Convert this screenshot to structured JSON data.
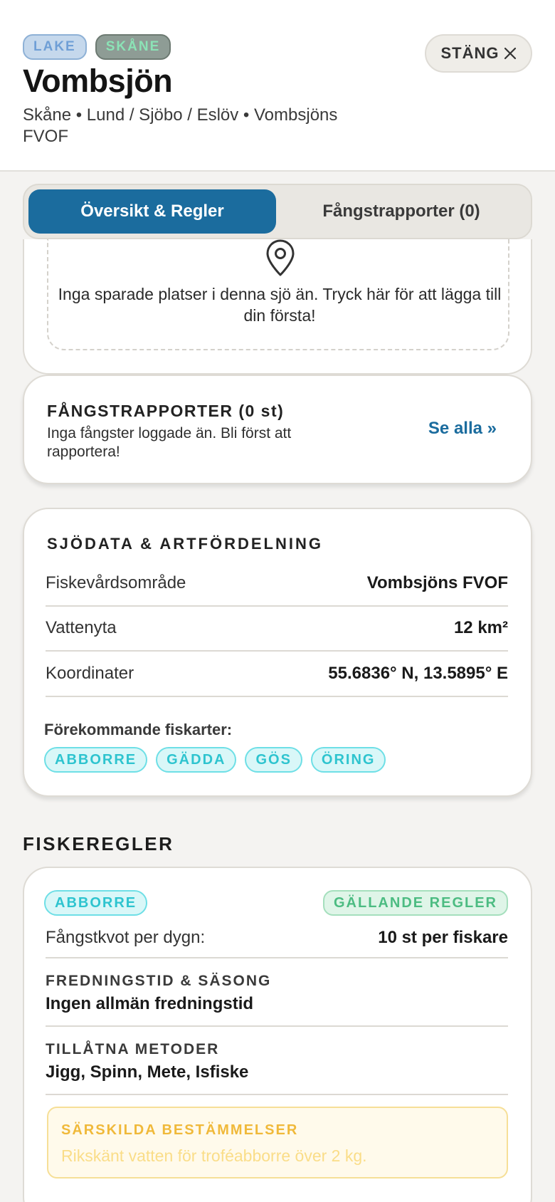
{
  "header": {
    "badges": {
      "type": "LAKE",
      "region": "SKÅNE"
    },
    "title": "Vombsjön",
    "subtitle": "Skåne • Lund / Sjöbo / Eslöv • Vombsjöns FVOF",
    "close_label": "STÄNG",
    "close_icon": "close-icon"
  },
  "tabs": {
    "overview": "Översikt & Regler",
    "reports": "Fångstrapporter (0)"
  },
  "places": {
    "icon": "map-pin-icon",
    "empty_text": "Inga sparade platser i denna sjö än. Tryck här för att lägga till din första!"
  },
  "catch_reports": {
    "title": "FÅNGSTRAPPORTER (0 st)",
    "empty_text": "Inga fångster loggade än. Bli först att rapportera!",
    "see_all": "Se alla »"
  },
  "lake_data": {
    "title": "SJÖDATA & ARTFÖRDELNING",
    "rows": [
      {
        "key": "Fiskevårdsområde",
        "value": "Vombsjöns FVOF"
      },
      {
        "key": "Vattenyta",
        "value": "12 km²"
      },
      {
        "key": "Koordinater",
        "value": "55.6836° N, 13.5895° E"
      }
    ],
    "species_label": "Förekommande fiskarter:",
    "species": [
      "ABBORRE",
      "GÄDDA",
      "GÖS",
      "ÖRING"
    ]
  },
  "rules": {
    "heading": "FISKEREGLER",
    "species": "ABBORRE",
    "status": "GÄLLANDE REGLER",
    "quota_label": "Fångstkvot per dygn:",
    "quota_value": "10 st per fiskare",
    "season_label": "FREDNINGSTID & SÄSONG",
    "season_value": "Ingen allmän fredningstid",
    "methods_label": "TILLÅTNA METODER",
    "methods_value": "Jigg, Spinn, Mete, Isfiske",
    "special_label": "SÄRSKILDA BESTÄMMELSER",
    "special_text": "Rikskänt vatten för troféabborre över 2 kg."
  },
  "colors": {
    "accent": "#1b6c9e",
    "chip_species": "#2ec4cf",
    "chip_valid": "#4cbc82",
    "warning": "#f0b93a"
  }
}
